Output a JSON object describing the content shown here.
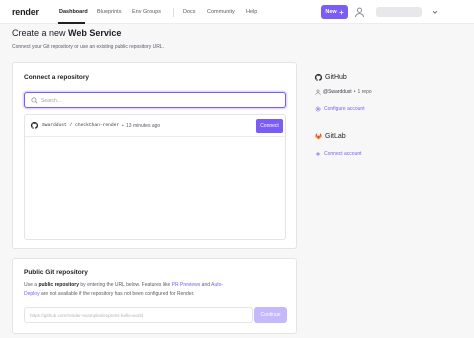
{
  "nav": {
    "logo": "render",
    "links": [
      "Dashboard",
      "Blueprints",
      "Env Groups",
      "Docs",
      "Community",
      "Help"
    ],
    "new_button": "New",
    "new_icon": "plus-icon",
    "accent": "#7c5cf6"
  },
  "header": {
    "title_prefix": "Create a new ",
    "title_bold": "Web Service",
    "subtitle": "Connect your Git repository or use an existing public repository URL."
  },
  "connect": {
    "title": "Connect a repository",
    "search_placeholder": "Search...",
    "repos": [
      {
        "name": "Swarddust / checkChan-render",
        "separator": "•",
        "time": "13 minutes ago",
        "button": "Connect"
      }
    ]
  },
  "public_repo": {
    "title": "Public Git repository",
    "desc_1": "Use a ",
    "desc_bold": "public repository",
    "desc_2": " by entering the URL below. Features like ",
    "link_1": "PR Previews",
    "desc_3": " and ",
    "link_2": "Auto-Deploy",
    "desc_4": " are not available if the repository has not been configured for Render.",
    "url_placeholder": "https://github.com/render-examples/express-hello-world",
    "continue": "Continue"
  },
  "sidebar": {
    "github": {
      "title": "GitHub",
      "user": "@Swarddust",
      "separator": "•",
      "repo_count": "1 repo",
      "link": "Configure account"
    },
    "gitlab": {
      "title": "GitLab",
      "link": "Connect account"
    }
  }
}
